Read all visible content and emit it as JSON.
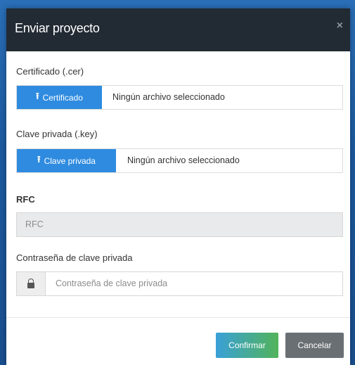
{
  "modal": {
    "title": "Enviar proyecto",
    "close_label": "×"
  },
  "certificate": {
    "label": "Certificado (.cer)",
    "button_label": "Certificado",
    "file_status": "Ningún archivo seleccionado"
  },
  "private_key": {
    "label": "Clave privada (.key)",
    "button_label": "Clave privada",
    "file_status": "Ningún archivo seleccionado"
  },
  "rfc": {
    "label": "RFC",
    "placeholder": "RFC"
  },
  "password": {
    "label": "Contraseña de clave privada",
    "placeholder": "Contraseña de clave privada"
  },
  "footer": {
    "confirm_label": "Confirmar",
    "cancel_label": "Cancelar"
  },
  "icons": {
    "upload": "upload-icon",
    "lock": "lock-icon",
    "close": "close-icon"
  },
  "colors": {
    "primary": "#2e8be0",
    "header": "#222a33",
    "cancel": "#6a6f74",
    "confirm_start": "#3aa0d8",
    "confirm_end": "#52b35a"
  }
}
